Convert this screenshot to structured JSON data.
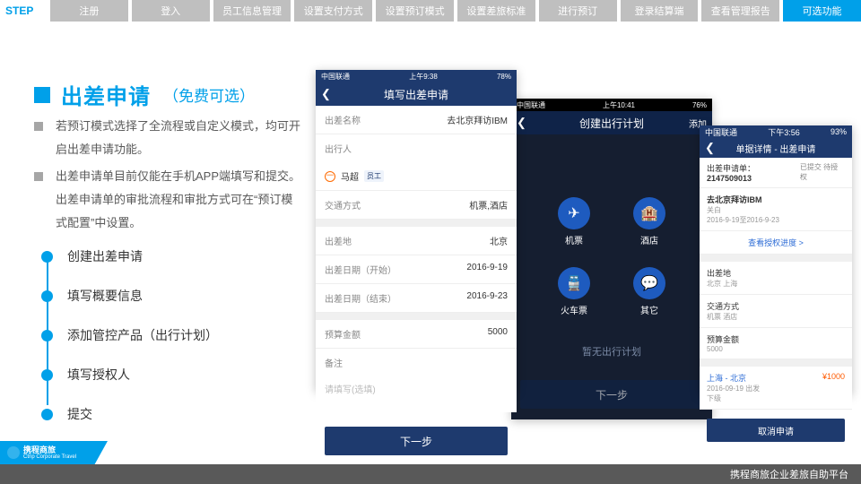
{
  "stepper": {
    "label": "STEP",
    "items": [
      "注册",
      "登入",
      "员工信息管理",
      "设置支付方式",
      "设置预订模式",
      "设置差旅标准",
      "进行预订",
      "登录结算端",
      "查看管理报告",
      "可选功能"
    ],
    "active_index": 9
  },
  "title": {
    "main": "出差申请",
    "sub": "（免费可选）"
  },
  "desc": [
    "若预订模式选择了全流程或自定义模式，均可开启出差申请功能。",
    "出差申请单目前仅能在手机APP端填写和提交。出差申请单的审批流程和审批方式可在“预订模式配置”中设置。"
  ],
  "flow": [
    "创建出差申请",
    "填写概要信息",
    "添加管控产品（出行计划）",
    "填写授权人",
    "提交"
  ],
  "footer": {
    "brand_cn": "携程商旅",
    "brand_en": "Ctrip Corporate Travel",
    "text": "携程商旅企业差旅自助平台"
  },
  "phone1": {
    "carrier": "中国联通",
    "time": "上午9:38",
    "battery": "78%",
    "title": "填写出差申请",
    "fields": {
      "name_label": "出差名称",
      "name_value": "去北京拜访IBM",
      "traveler_label": "出行人",
      "traveler_name": "马超",
      "traveler_role": "员工",
      "transport_label": "交通方式",
      "transport_value": "机票,酒店",
      "dest_label": "出差地",
      "dest_value": "北京",
      "start_label": "出差日期（开始）",
      "start_value": "2016-9-19",
      "end_label": "出差日期（结束）",
      "end_value": "2016-9-23",
      "budget_label": "预算金额",
      "budget_value": "5000",
      "memo_label": "备注",
      "memo_placeholder": "请填写(选填)"
    },
    "next": "下一步"
  },
  "phone2": {
    "carrier": "中国联通",
    "time": "上午10:41",
    "battery": "76%",
    "title": "创建出行计划",
    "right": "添加",
    "icons": [
      {
        "glyph": "✈",
        "label": "机票"
      },
      {
        "glyph": "🏨",
        "label": "酒店"
      },
      {
        "glyph": "🚆",
        "label": "火车票"
      },
      {
        "glyph": "💬",
        "label": "其它"
      }
    ],
    "empty": "暂无出行计划",
    "next": "下一步"
  },
  "phone3": {
    "carrier": "中国联通",
    "time": "下午3:56",
    "battery": "93%",
    "title": "单据详情 - 出差申请",
    "order_no_label": "出差申请单：",
    "order_no": "2147509013",
    "status": "已提交  待授权",
    "trip_title": "去北京拜访IBM",
    "trip_sub": "关白",
    "trip_dates": "2016-9-19至2016-9-23",
    "link": "查看授权进度 >",
    "dest_label": "出差地",
    "dest_value": "北京 上海",
    "transport_label": "交通方式",
    "transport_value": "机票 酒店",
    "budget_label": "预算金额",
    "budget_value": "5000",
    "seg_route": "上海 - 北京",
    "seg_price": "¥1000",
    "seg_date": "2016-09-19 出发",
    "seg_note": "下级",
    "cancel": "取消申请"
  }
}
